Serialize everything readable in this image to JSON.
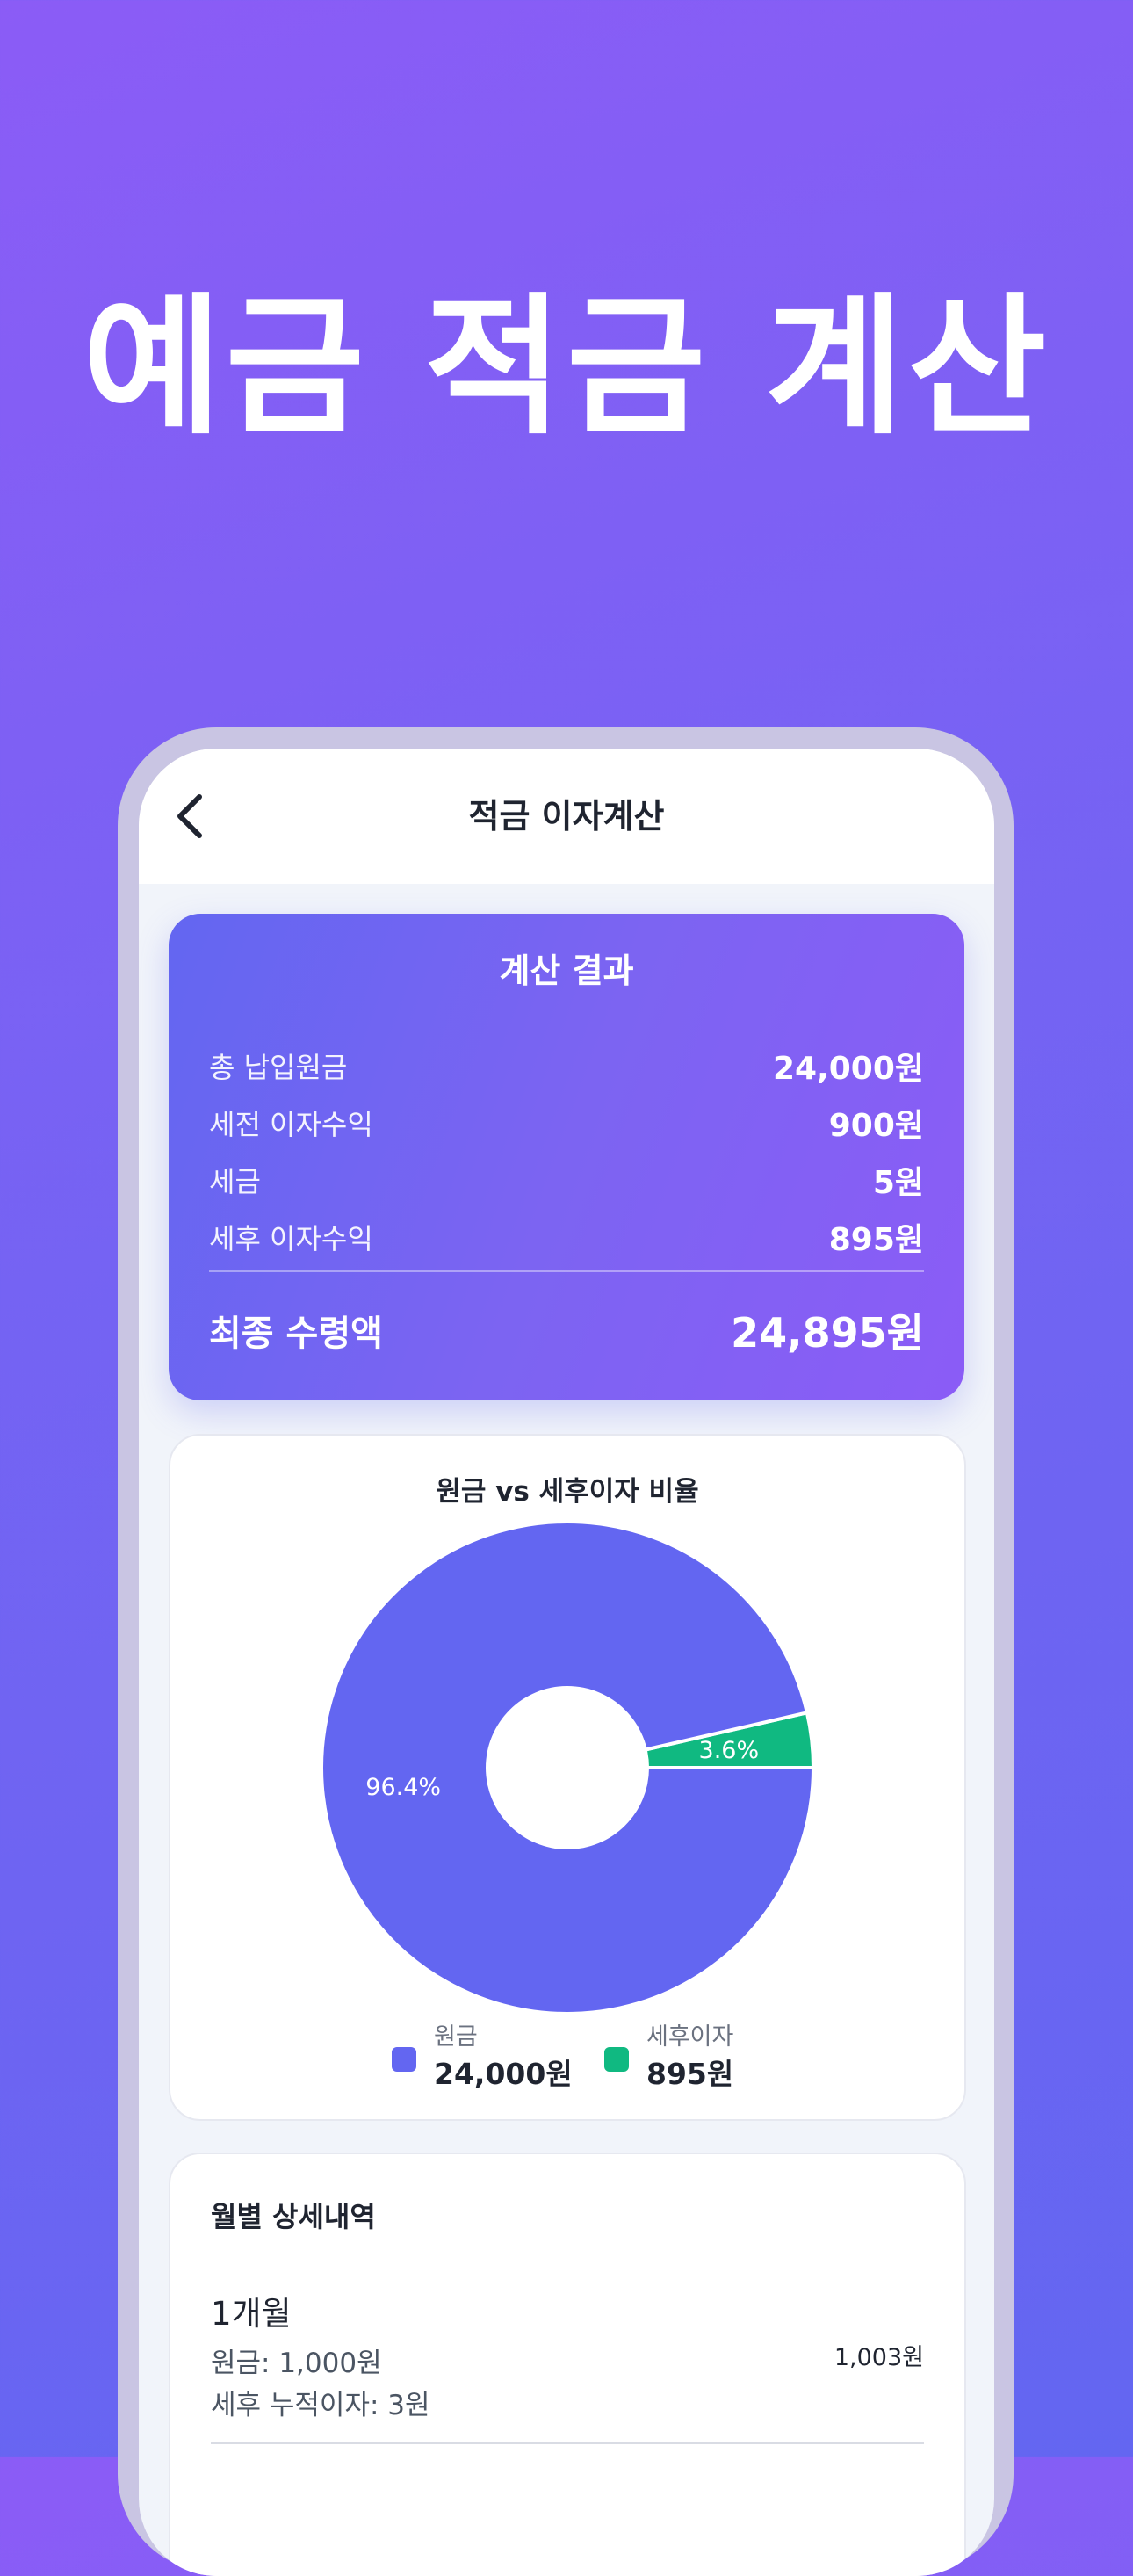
{
  "hero": {
    "title": "예금 적금 계산"
  },
  "nav": {
    "title": "적금 이자계산",
    "back_icon": "chevron-left-icon"
  },
  "result": {
    "title": "계산 결과",
    "rows": [
      {
        "label": "총 납입원금",
        "value": "24,000원"
      },
      {
        "label": "세전 이자수익",
        "value": "900원"
      },
      {
        "label": "세금",
        "value": "5원"
      },
      {
        "label": "세후 이자수익",
        "value": "895원"
      }
    ],
    "final": {
      "label": "최종 수령액",
      "value": "24,895원"
    },
    "colors": {
      "start": "#6366f1",
      "end": "#8b5cf6"
    }
  },
  "chart": {
    "title": "원금 vs 세후이자 비율",
    "legend": [
      {
        "name": "원금",
        "value": "24,000원",
        "color": "#6366f1"
      },
      {
        "name": "세후이자",
        "value": "895원",
        "color": "#10b981"
      }
    ]
  },
  "chart_data": {
    "type": "pie",
    "title": "원금 vs 세후이자 비율",
    "categories": [
      "원금",
      "세후이자"
    ],
    "values": [
      24000,
      895
    ],
    "percent_labels": [
      "96.4%",
      "3.6%"
    ],
    "colors": [
      "#6366f1",
      "#10b981"
    ],
    "donut": true,
    "legend_position": "bottom"
  },
  "monthly": {
    "title": "월별 상세내역",
    "items": [
      {
        "month": "1개월",
        "principal": "원금: 1,000원",
        "interest": "세후 누적이자: 3원",
        "total": "1,003원"
      }
    ]
  }
}
